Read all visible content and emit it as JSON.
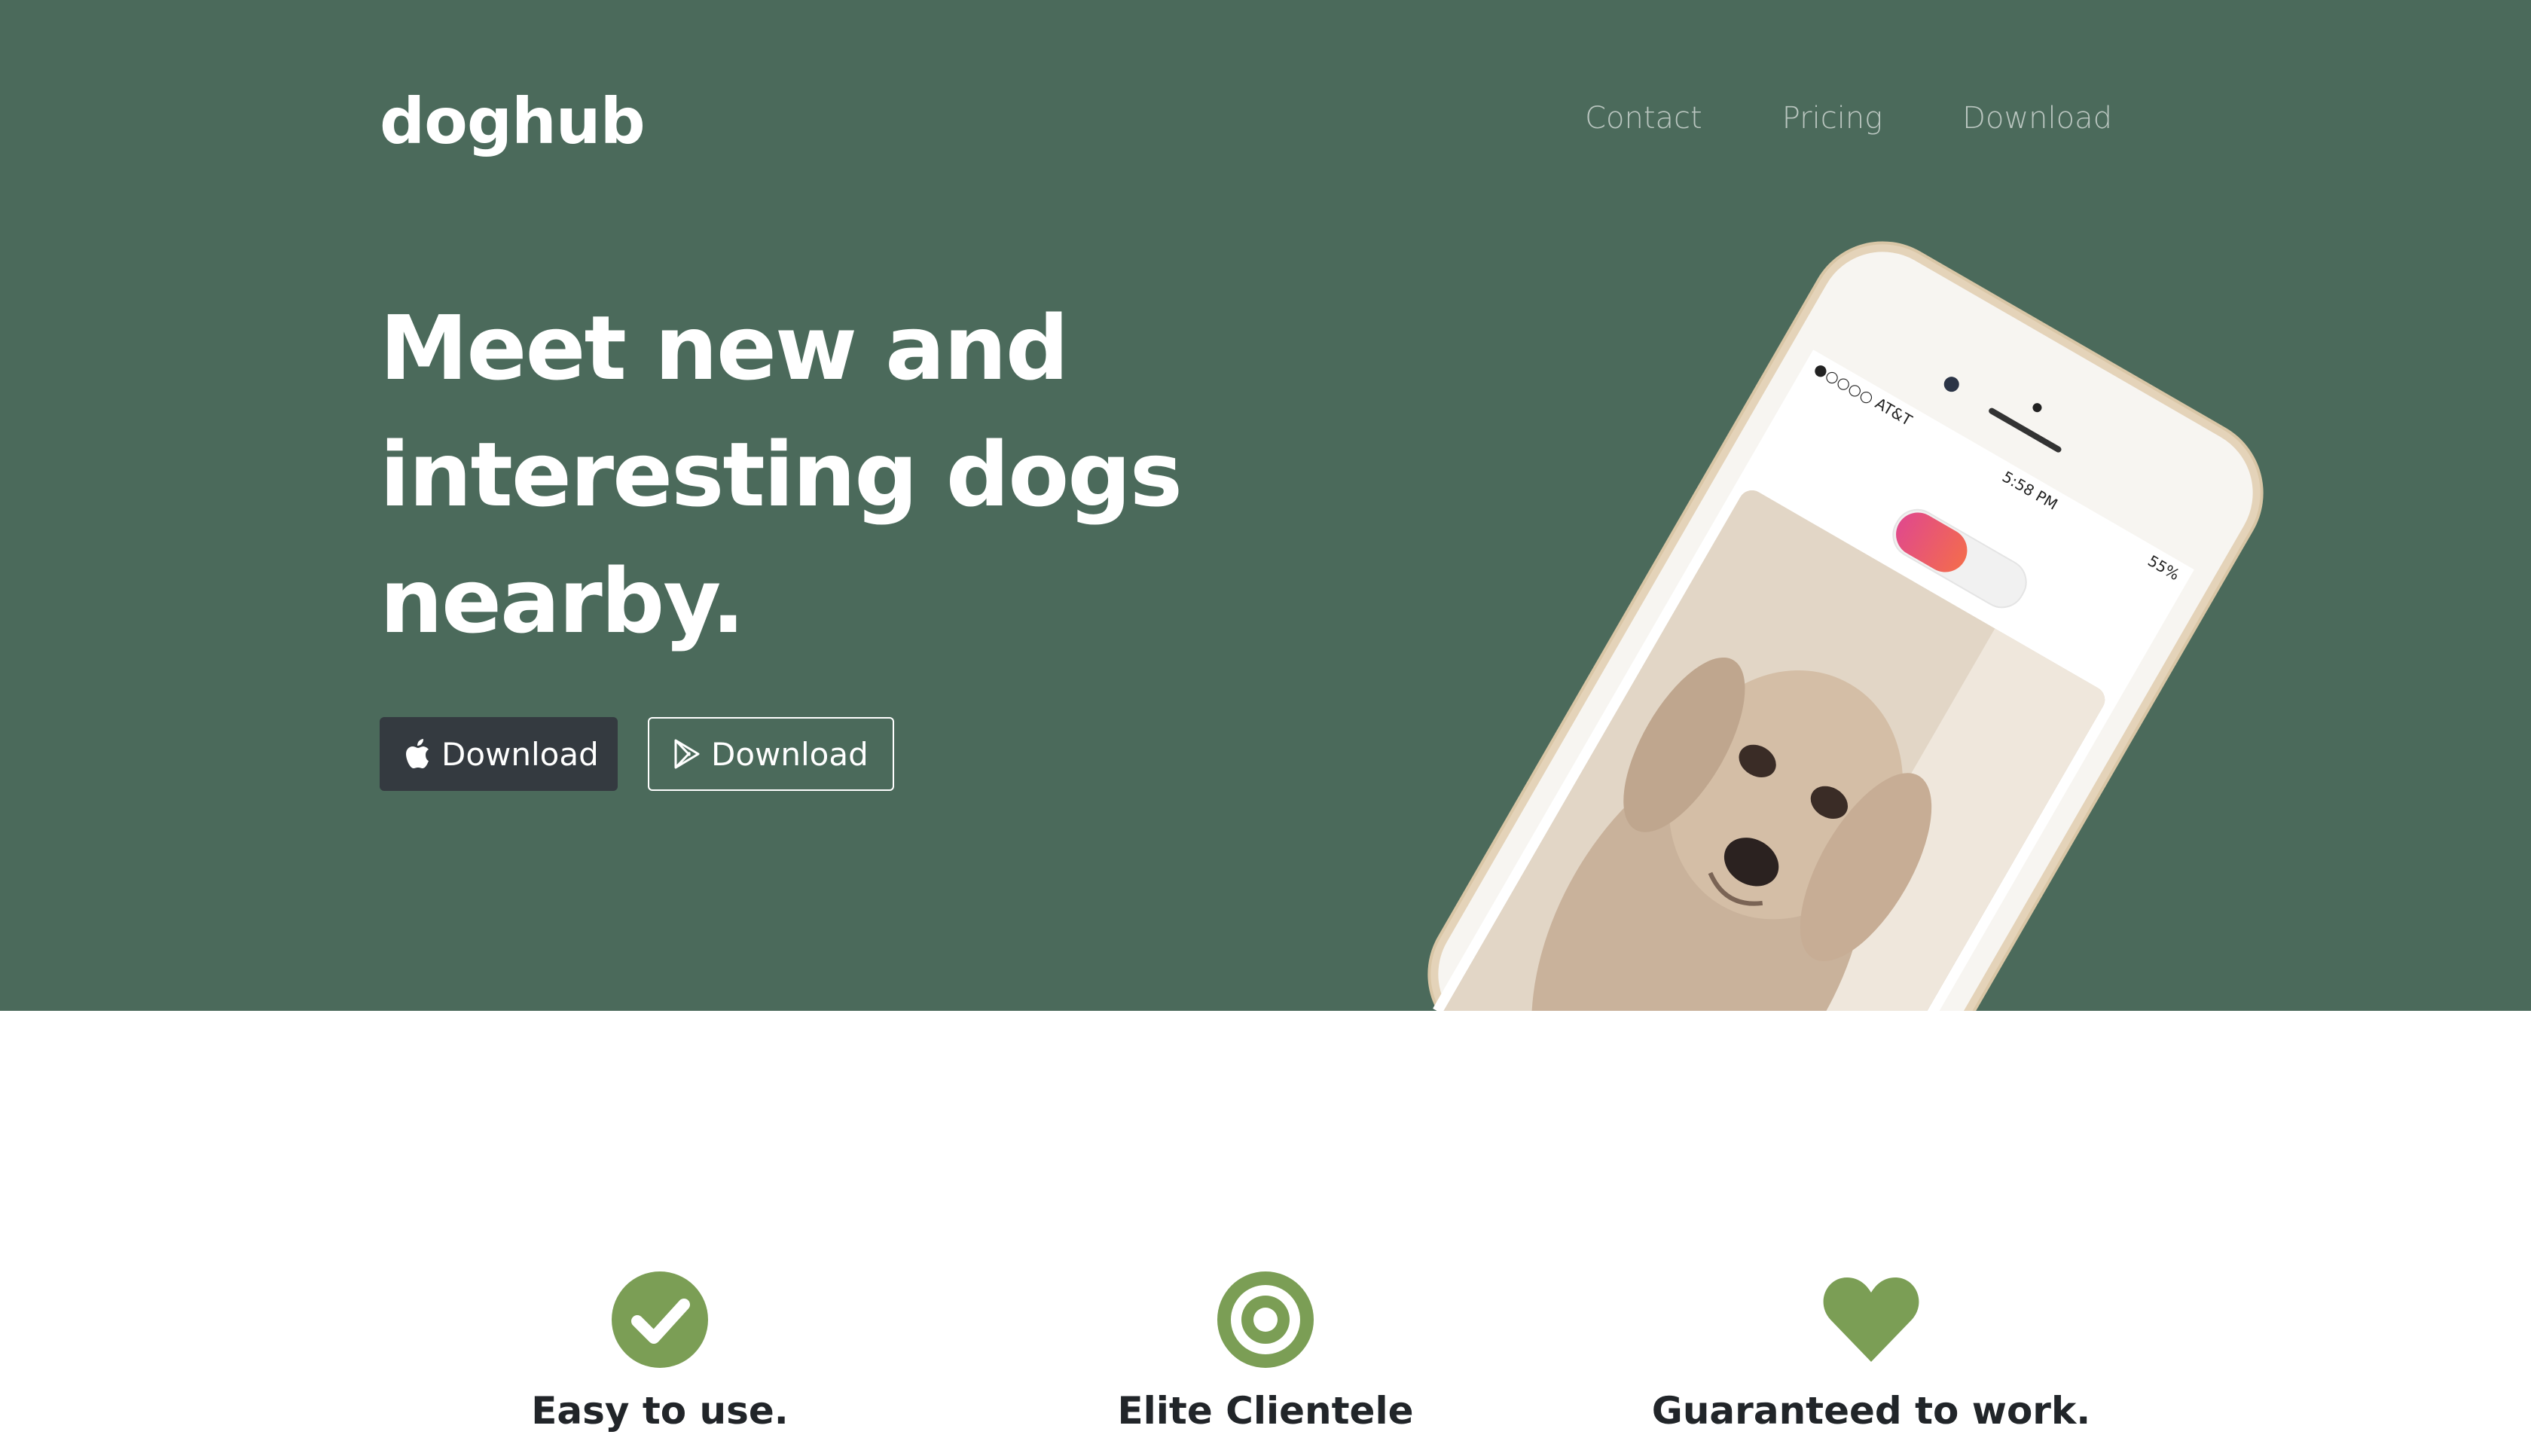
{
  "brand": {
    "logo": "doghub"
  },
  "nav": {
    "items": [
      "Contact",
      "Pricing",
      "Download"
    ]
  },
  "hero": {
    "headline_lines": [
      "Meet new and",
      "interesting dogs",
      "nearby."
    ],
    "buttons": {
      "app_store": {
        "label": "Download",
        "icon": "apple-icon"
      },
      "play_store": {
        "label": "Download",
        "icon": "google-play-icon"
      }
    }
  },
  "phone": {
    "carrier": "●○○○○ AT&T",
    "time": "5:58 PM",
    "battery": "55%"
  },
  "features": [
    {
      "title": "Easy to use.",
      "icon": "check-circle-icon"
    },
    {
      "title": "Elite Clientele",
      "icon": "target-icon"
    },
    {
      "title": "Guaranteed to work.",
      "icon": "heart-icon"
    }
  ],
  "colors": {
    "hero_bg": "#4b6a5b",
    "accent": "#7b9e55",
    "dark_button": "#343a40"
  }
}
